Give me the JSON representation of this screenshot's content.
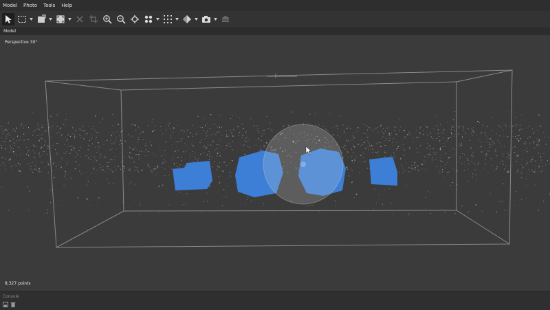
{
  "menu": [
    "Model",
    "Photo",
    "Tools",
    "Help"
  ],
  "toolbar": {
    "icons": [
      "select-cursor-icon",
      "rect-select-icon",
      "resize-icon",
      "rotate-object-icon",
      "delete-x-icon",
      "crop-icon",
      "zoom-in-icon",
      "zoom-out-icon",
      "reset-view-icon",
      "point-cloud-icon",
      "grid-icon",
      "shading-icon",
      "camera-icon",
      "model-icon"
    ]
  },
  "tabs": {
    "model": "Model"
  },
  "viewport": {
    "view_label": "Perspective 30°",
    "points_label": "8,327 points"
  },
  "console": {
    "title": "Console"
  },
  "colors": {
    "camera_blue": "#3d7fd6",
    "bbox_line": "#8a8a8a",
    "background": "#3b3b3b"
  }
}
